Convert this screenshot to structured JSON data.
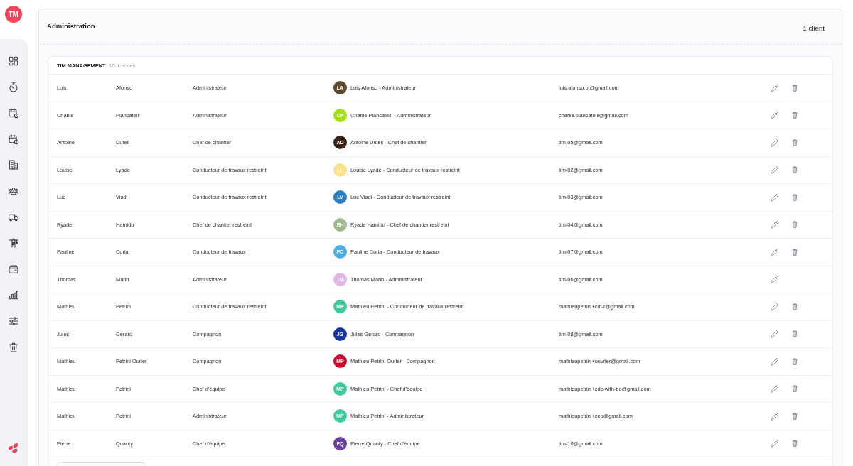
{
  "sidebar": {
    "user_initials": "TM"
  },
  "header": {
    "title": "Administration",
    "client_count": "1 client"
  },
  "client": {
    "name": "TIM MANAGEMENT",
    "licences": "15 licences",
    "rows": [
      {
        "first_name": "Luis",
        "last_name": "Afonso",
        "role": "Administrateur",
        "initials": "LA",
        "color": "#5c4a2e",
        "display_name": "Luis Afonso - Administrateur",
        "email": "luis.afonso.pt@gmail.com",
        "deletable": true
      },
      {
        "first_name": "Charlie",
        "last_name": "Piancatelli",
        "role": "Administrateur",
        "initials": "CP",
        "color": "#a3e01a",
        "display_name": "Charlie Piancatelli - Administrateur",
        "email": "charlie.piancatelli@gmail.com",
        "deletable": true
      },
      {
        "first_name": "Antoine",
        "last_name": "Duteil",
        "role": "Chef de chantier",
        "initials": "AD",
        "color": "#3d2218",
        "display_name": "Antoine Duteil - Chef de chantier",
        "email": "tim-05@gmail.com",
        "deletable": true
      },
      {
        "first_name": "Louise",
        "last_name": "Lyade",
        "role": "Conducteur de travaux restreint",
        "initials": "LL",
        "color": "#fde08a",
        "display_name": "Louise Lyade - Conducteur de travaux restreint",
        "email": "tim-02@gmail.com",
        "deletable": true
      },
      {
        "first_name": "Luc",
        "last_name": "Viadi",
        "role": "Conducteur de travaux restreint",
        "initials": "LV",
        "color": "#2a7dc0",
        "display_name": "Luc Viadi - Conducteur de travaux restreint",
        "email": "tim-03@gmail.com",
        "deletable": true
      },
      {
        "first_name": "Ryade",
        "last_name": "Hamidu",
        "role": "Chef de chantier restreint",
        "initials": "RH",
        "color": "#9db88a",
        "display_name": "Ryade Hamidu - Chef de chantier restreint",
        "email": "tim-04@gmail.com",
        "deletable": true
      },
      {
        "first_name": "Pauline",
        "last_name": "Coria",
        "role": "Conducteur de travaux",
        "initials": "PC",
        "color": "#4daee3",
        "display_name": "Pauline Coria - Conducteur de travaux",
        "email": "tim-07@gmail.com",
        "deletable": true
      },
      {
        "first_name": "Thomas",
        "last_name": "Marin",
        "role": "Administrateur",
        "initials": "TM",
        "color": "#e3b8e8",
        "display_name": "Thomas Marin - Administrateur",
        "email": "tim-06@gmail.com",
        "deletable": false
      },
      {
        "first_name": "Mathieu",
        "last_name": "Petrini",
        "role": "Conducteur de travaux restreint",
        "initials": "MP",
        "color": "#3ecb9a",
        "display_name": "Mathieu Petrini - Conducteur de travaux restreint",
        "email": "mathieupetrini+cdt-r@gmail.com",
        "deletable": true
      },
      {
        "first_name": "Jules",
        "last_name": "Gerard",
        "role": "Compagnon",
        "initials": "JG",
        "color": "#1434a4",
        "display_name": "Jules Gerard - Compagnon",
        "email": "tim-08@gmail.com",
        "deletable": true
      },
      {
        "first_name": "Mathieu",
        "last_name": "Petrini Ourier",
        "role": "Compagnon",
        "initials": "MP",
        "color": "#c8102e",
        "display_name": "Mathieu Petrini Ourier - Compagnon",
        "email": "mathieupetrini+ouvrier@gmail.com",
        "deletable": true
      },
      {
        "first_name": "Mathieu",
        "last_name": "Petrini",
        "role": "Chef d'équipe",
        "initials": "MP",
        "color": "#3ecb9a",
        "display_name": "Mathieu Petrini - Chef d'équipe",
        "email": "mathieupetrini+cdc-with-bo@gmail.com",
        "deletable": true
      },
      {
        "first_name": "Mathieu",
        "last_name": "Petrini",
        "role": "Administrateur",
        "initials": "MP",
        "color": "#3ecb9a",
        "display_name": "Mathieu Petrini - Administrateur",
        "email": "mathieupetrini+ceo@gmail.com",
        "deletable": true
      },
      {
        "first_name": "Pierre",
        "last_name": "Quanty",
        "role": "Chef d'équipe",
        "initials": "PQ",
        "color": "#6b3fa0",
        "display_name": "Pierre Quanty - Chef d'équipe",
        "email": "tim-10@gmail.com",
        "deletable": true
      }
    ]
  }
}
